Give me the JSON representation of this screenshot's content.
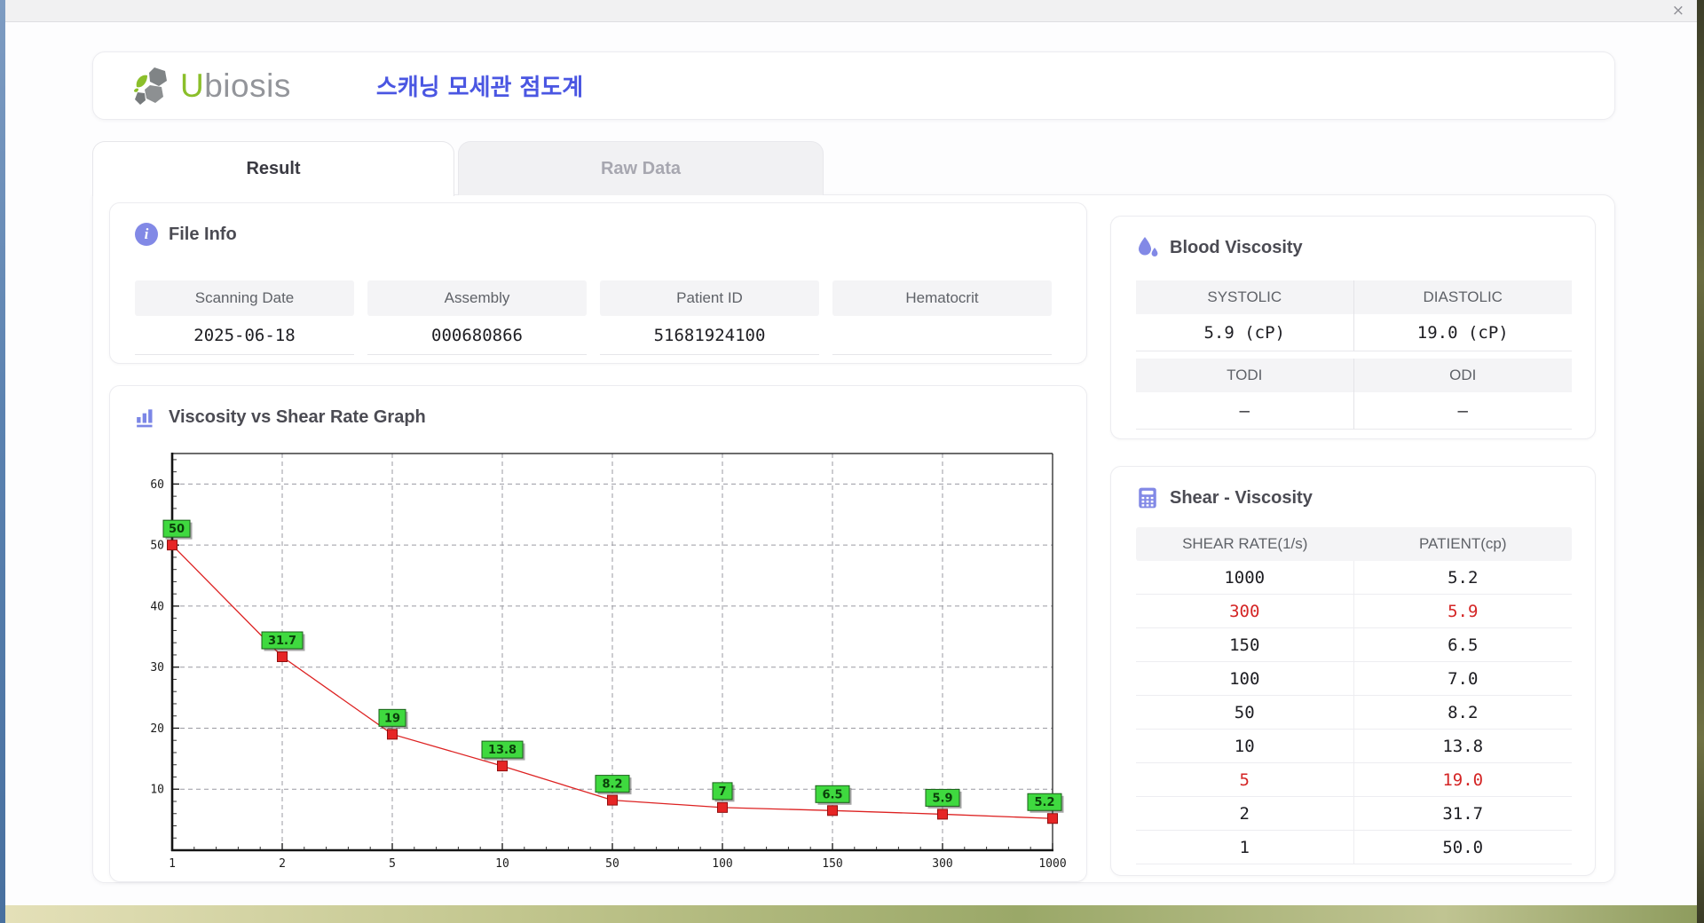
{
  "window": {
    "close_glyph": "×"
  },
  "header": {
    "logo_u": "U",
    "logo_rest": "biosis",
    "subtitle": "스캐닝 모세관 점도계"
  },
  "tabs": [
    {
      "label": "Result",
      "active": true
    },
    {
      "label": "Raw Data",
      "active": false
    }
  ],
  "file_info": {
    "title": "File Info",
    "icon_glyph": "i",
    "fields": [
      {
        "label": "Scanning Date",
        "value": "2025-06-18"
      },
      {
        "label": "Assembly",
        "value": "000680866"
      },
      {
        "label": "Patient ID",
        "value": "51681924100"
      },
      {
        "label": "Hematocrit",
        "value": ""
      }
    ]
  },
  "blood_viscosity": {
    "title": "Blood Viscosity",
    "groups": [
      {
        "cells": [
          {
            "label": "SYSTOLIC",
            "value": "5.9 (cP)"
          },
          {
            "label": "DIASTOLIC",
            "value": "19.0 (cP)"
          }
        ]
      },
      {
        "cells": [
          {
            "label": "TODI",
            "value": "–"
          },
          {
            "label": "ODI",
            "value": "–"
          }
        ]
      }
    ]
  },
  "shear_viscosity": {
    "title": "Shear - Viscosity",
    "columns": [
      "SHEAR RATE(1/s)",
      "PATIENT(cp)"
    ],
    "rows": [
      {
        "shear": "1000",
        "patient": "5.2",
        "highlight": false
      },
      {
        "shear": "300",
        "patient": "5.9",
        "highlight": true
      },
      {
        "shear": "150",
        "patient": "6.5",
        "highlight": false
      },
      {
        "shear": "100",
        "patient": "7.0",
        "highlight": false
      },
      {
        "shear": "50",
        "patient": "8.2",
        "highlight": false
      },
      {
        "shear": "10",
        "patient": "13.8",
        "highlight": false
      },
      {
        "shear": "5",
        "patient": "19.0",
        "highlight": true
      },
      {
        "shear": "2",
        "patient": "31.7",
        "highlight": false
      },
      {
        "shear": "1",
        "patient": "50.0",
        "highlight": false
      }
    ]
  },
  "chart_data": {
    "type": "line",
    "title": "Viscosity vs Shear Rate Graph",
    "x": [
      1,
      2,
      5,
      10,
      50,
      100,
      150,
      300,
      1000
    ],
    "y": [
      50,
      31.7,
      19,
      13.8,
      8.2,
      7,
      6.5,
      5.9,
      5.2
    ],
    "point_labels": [
      "50",
      "31.7",
      "19",
      "13.8",
      "8.2",
      "7",
      "6.5",
      "5.9",
      "5.2"
    ],
    "x_tick_labels": [
      "1",
      "2",
      "5",
      "10",
      "50",
      "100",
      "150",
      "300",
      "1000"
    ],
    "y_ticks": [
      10,
      20,
      30,
      40,
      50,
      60
    ],
    "ylim": [
      0,
      65
    ],
    "x_scale": "categorical-even",
    "grid": "dashed",
    "legend": "none",
    "line_color": "#dd2222",
    "marker_style": "red-square",
    "label_box_color": "#3fd93f"
  },
  "colors": {
    "accent_periwinkle": "#8289e6",
    "subtitle_blue": "#4a56e2",
    "highlight_red": "#d42525",
    "logo_green": "#8bbf2a"
  }
}
